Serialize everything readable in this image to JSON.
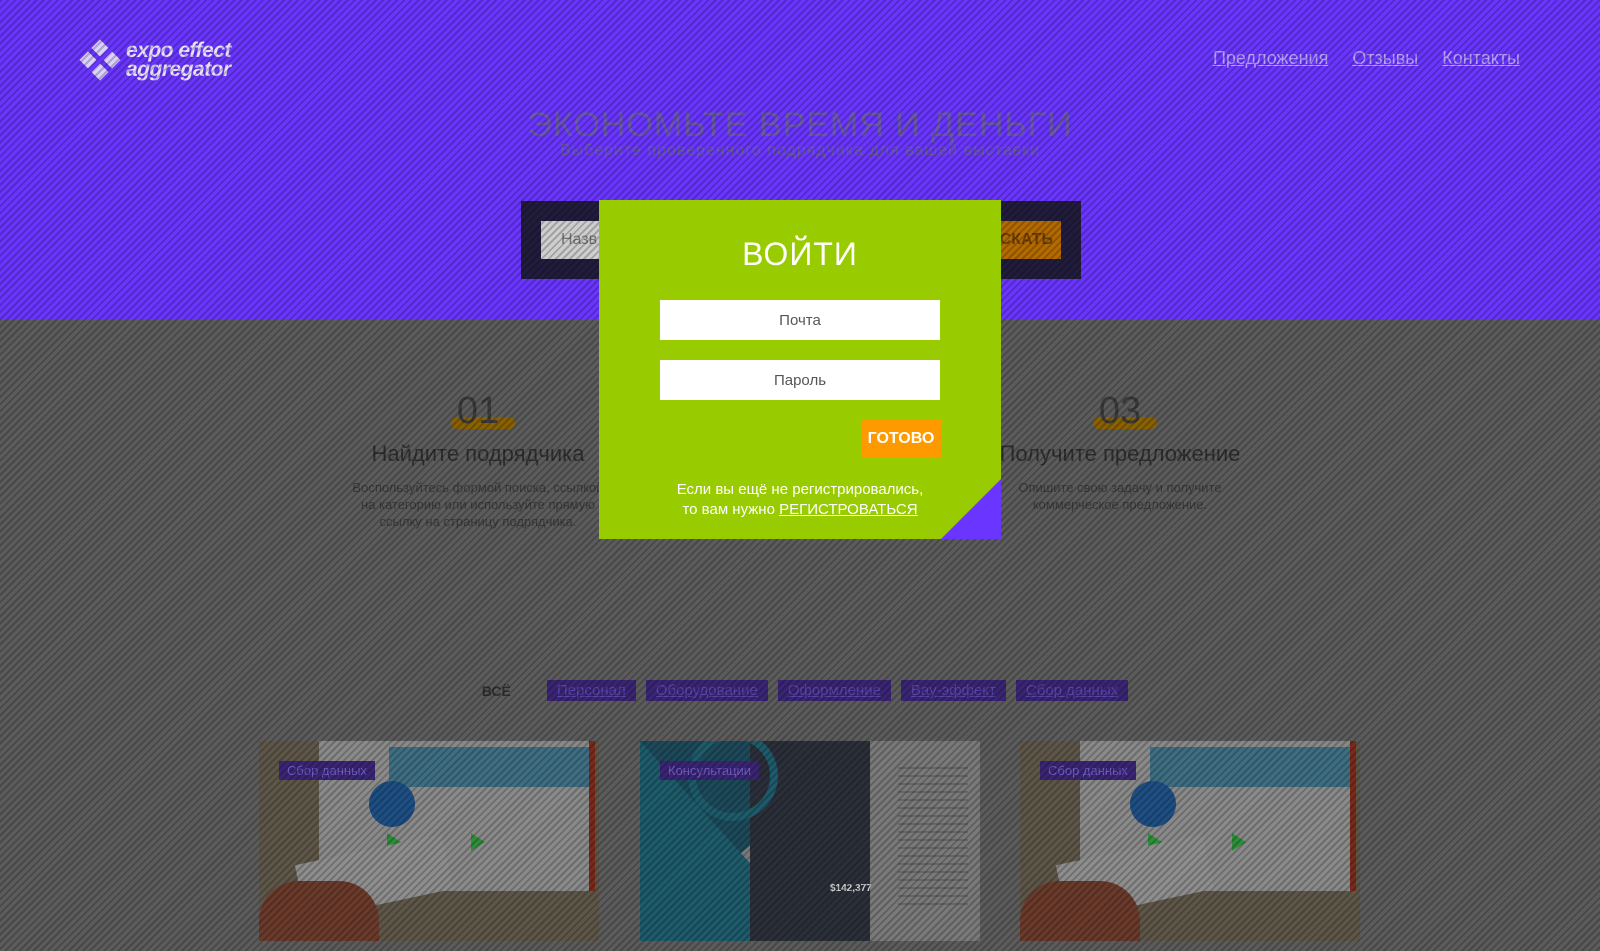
{
  "header": {
    "logo_line1": "expo effect",
    "logo_line2": "aggregator",
    "nav": [
      "Предложения",
      "Отзывы",
      "Контакты"
    ]
  },
  "hero": {
    "title": "ЭКОНОМЬТЕ ВРЕМЯ И ДЕНЬГИ",
    "subtitle": "Выберите проверенного подрядчика для вашей выставки",
    "search_placeholder": "Назв",
    "search_button": "ИСКАТЬ"
  },
  "steps": [
    {
      "num": "01",
      "title": "Найдите подрядчика",
      "desc": "Воспользуйтесь формой поиска, ссылкой на категорию или используйте прямую ссылку на страницу подрядчика."
    },
    {
      "num": "03",
      "title": "Получите предложение",
      "desc": "Опишите свою задачу и получите коммерческое предложение."
    }
  ],
  "filters": {
    "all": "ВСЁ",
    "items": [
      "Персонал",
      "Оборудование",
      "Оформление",
      "Вау-эффект",
      "Сбор данных"
    ]
  },
  "cards": [
    {
      "tag": "Сбор данных"
    },
    {
      "tag": "Консультации"
    },
    {
      "tag": "Сбор данных"
    }
  ],
  "card_b_price": "$142,377",
  "modal": {
    "title": "ВОЙТИ",
    "email_placeholder": "Почта",
    "password_placeholder": "Пароль",
    "submit": "ГОТОВО",
    "note_line1": "Если вы ещё не регистрировались,",
    "note_line2": "то вам нужно",
    "register_link": "РЕГИСТРОВАТЬСЯ"
  },
  "colors": {
    "hero_purple": "#6a36ff",
    "modal_green": "#99cc00",
    "accent_orange": "#ff9900"
  }
}
